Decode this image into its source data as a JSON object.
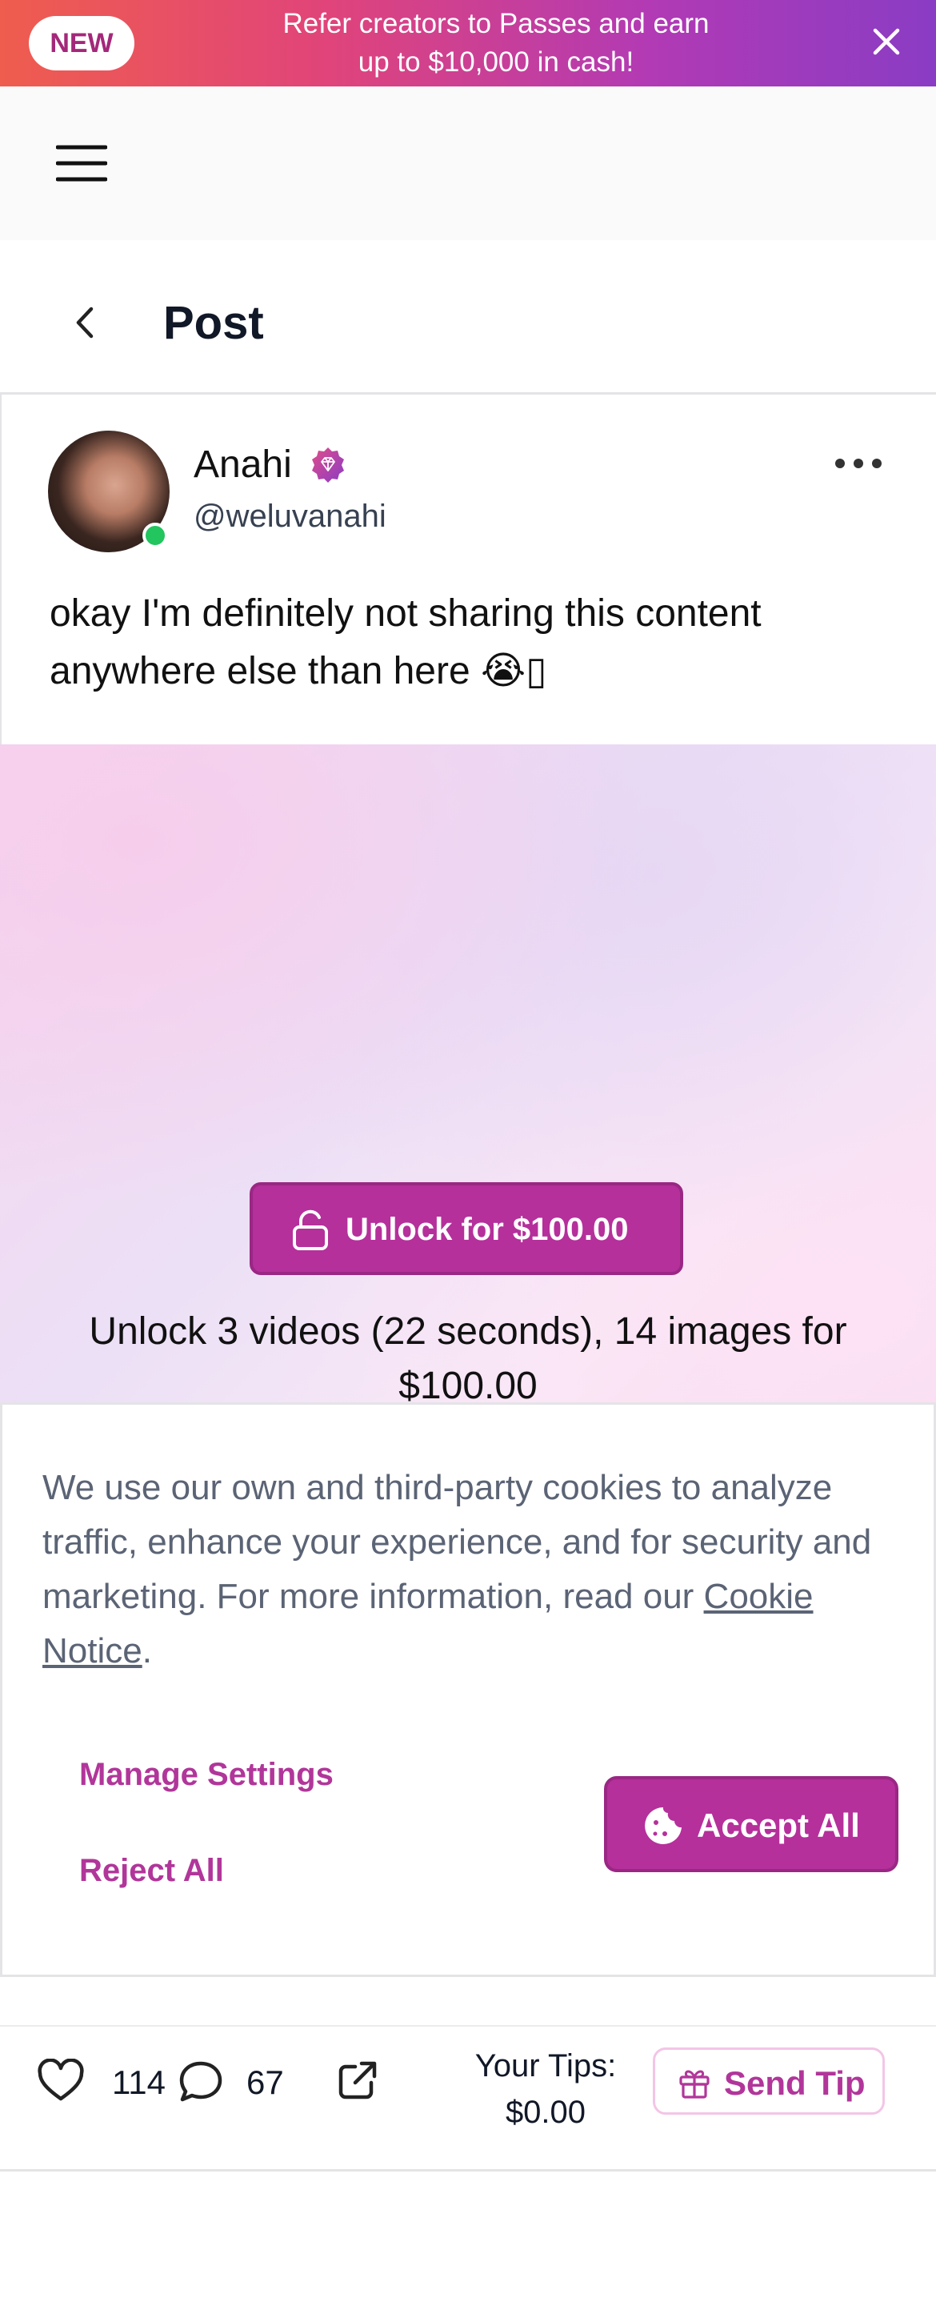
{
  "promo_banner": {
    "badge": "NEW",
    "text_line1": "Refer creators to Passes and earn",
    "text_line2": "up to $10,000 in cash!",
    "close_icon": "close-icon"
  },
  "navbar": {
    "menu_icon": "hamburger-icon"
  },
  "header": {
    "back_icon": "chevron-left-icon",
    "title": "Post"
  },
  "post": {
    "creator_name": "Anahi",
    "handle": "@weluvanahi",
    "verified_icon": "diamond-badge-icon",
    "online": true,
    "text": "okay I'm definitely not sharing this content anywhere else than here 😭▯"
  },
  "locked_media": {
    "unlock_button": "Unlock for $100.00",
    "description": "Unlock 3 videos (22 seconds), 14 images for $100.00"
  },
  "cookie_banner": {
    "text": "We use our own and third-party cookies to analyze traffic, enhance your experience, and for security and marketing. For more information, read our ",
    "link": "Cookie Notice",
    "text_end": ".",
    "manage_settings": "Manage Settings",
    "reject_all": "Reject All",
    "accept_all": "Accept All"
  },
  "actions": {
    "likes": "114",
    "comments": "67",
    "tips_label": "Your Tips:",
    "tips_value": "$0.00",
    "send_tip": "Send Tip"
  },
  "colors": {
    "accent": "#b5309b",
    "link": "#b1369a",
    "banner_start": "#ef5d4e",
    "banner_end": "#8a3cc4"
  }
}
